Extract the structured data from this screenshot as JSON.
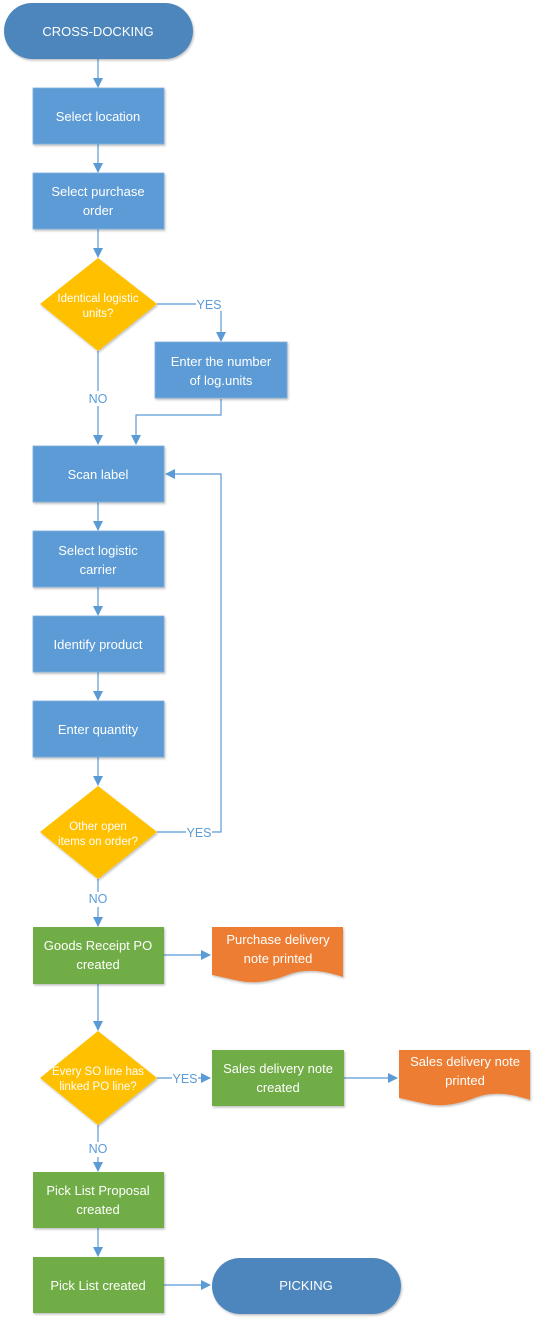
{
  "colors": {
    "terminator": "#4e86bc",
    "process_blue": "#5b9bd5",
    "process_green": "#70ad47",
    "decision": "#ffc000",
    "document": "#ed7d31",
    "connector": "#5b9bd5",
    "text": "#ffffff"
  },
  "nodes": {
    "start": {
      "type": "terminator",
      "lines": [
        "CROSS-DOCKING"
      ]
    },
    "select_location": {
      "type": "process",
      "lines": [
        "Select location"
      ]
    },
    "select_po": {
      "type": "process",
      "lines": [
        "Select purchase",
        "order"
      ]
    },
    "identical_units": {
      "type": "decision",
      "lines": [
        "Identical logistic",
        "units?"
      ]
    },
    "enter_number": {
      "type": "process",
      "lines": [
        "Enter the number",
        "of log.units"
      ]
    },
    "scan_label": {
      "type": "process",
      "lines": [
        "Scan label"
      ]
    },
    "select_carrier": {
      "type": "process",
      "lines": [
        "Select logistic",
        "carrier"
      ]
    },
    "identify_product": {
      "type": "process",
      "lines": [
        "Identify product"
      ]
    },
    "enter_quantity": {
      "type": "process",
      "lines": [
        "Enter quantity"
      ]
    },
    "other_open": {
      "type": "decision",
      "lines": [
        "Other open",
        "items on order?"
      ]
    },
    "goods_receipt": {
      "type": "process",
      "lines": [
        "Goods Receipt PO",
        "created"
      ]
    },
    "purchase_note": {
      "type": "document",
      "lines": [
        "Purchase delivery",
        "note printed"
      ]
    },
    "every_so": {
      "type": "decision",
      "lines": [
        "Every SO line has",
        "linked PO line?"
      ]
    },
    "sales_note_created": {
      "type": "process",
      "lines": [
        "Sales delivery note",
        "created"
      ]
    },
    "sales_note_printed": {
      "type": "document",
      "lines": [
        "Sales delivery note",
        "printed"
      ]
    },
    "pick_proposal": {
      "type": "process",
      "lines": [
        "Pick List Proposal",
        "created"
      ]
    },
    "pick_list": {
      "type": "process",
      "lines": [
        "Pick List created"
      ]
    },
    "end": {
      "type": "terminator",
      "lines": [
        "PICKING"
      ]
    }
  },
  "edge_labels": {
    "identical_yes": "YES",
    "identical_no": "NO",
    "other_yes": "YES",
    "other_no": "NO",
    "every_yes": "YES",
    "every_no": "NO"
  }
}
